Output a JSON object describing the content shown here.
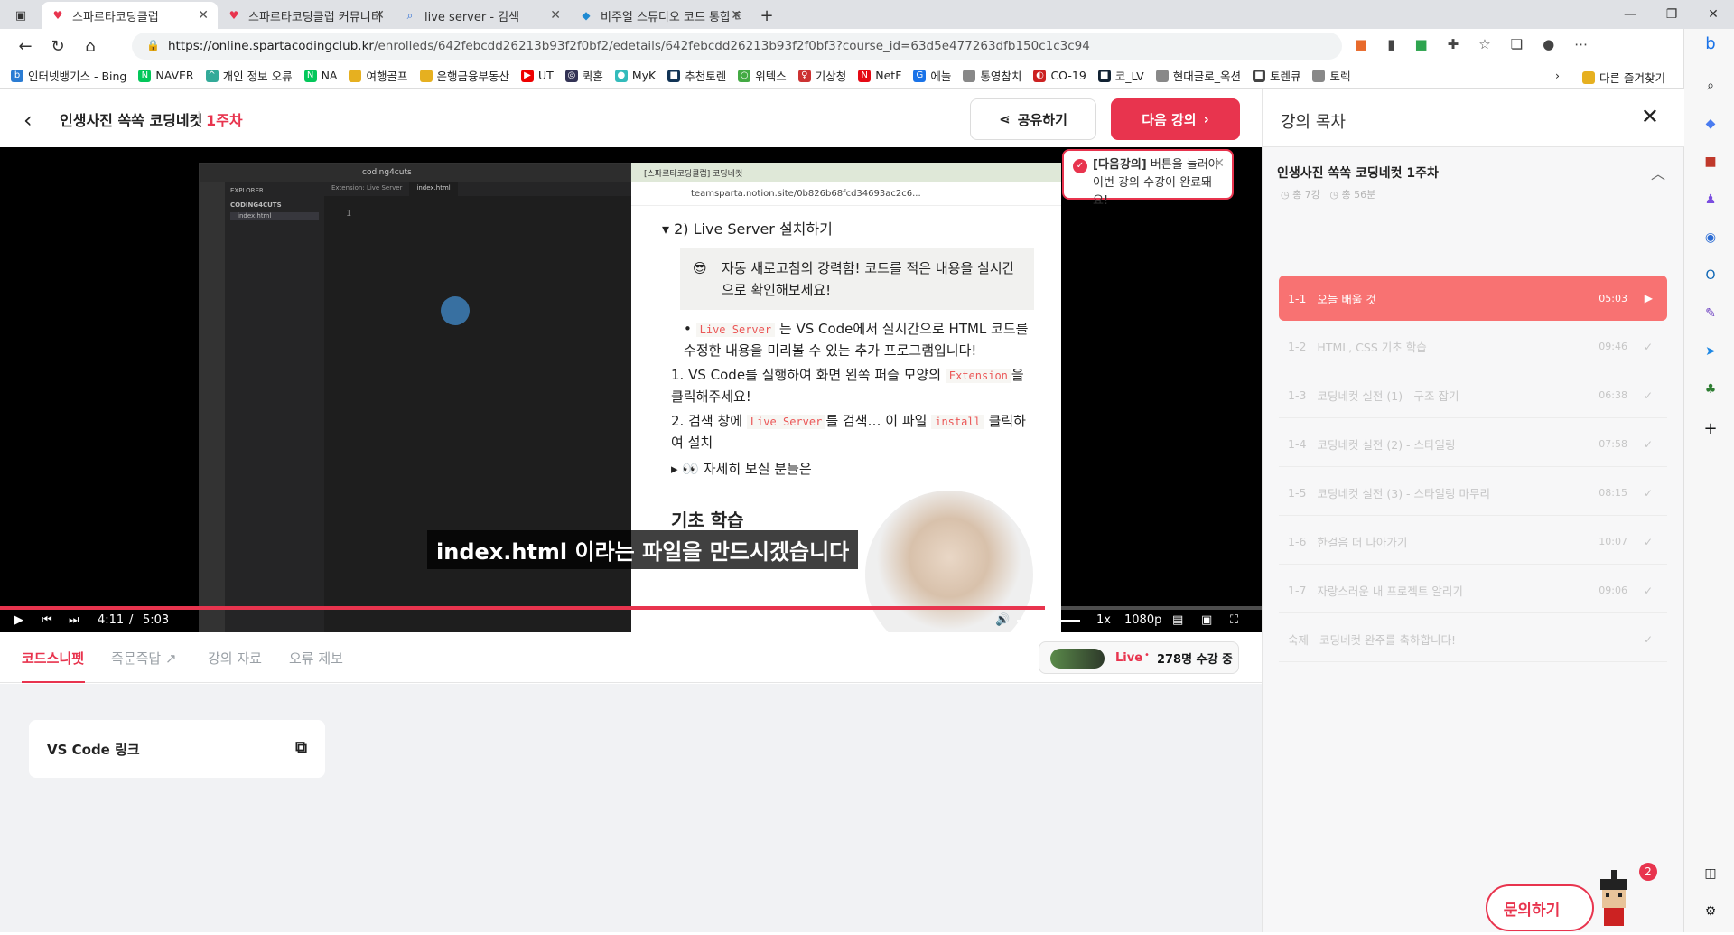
{
  "browser": {
    "tabs": [
      {
        "title": "스파르타코딩클럽",
        "active": true
      },
      {
        "title": "스파르타코딩클럽 커뮤니티 | 스파",
        "active": false
      },
      {
        "title": "live server - 검색",
        "active": false
      },
      {
        "title": "비주얼 스튜디오 코드 통합 터미",
        "active": false
      }
    ],
    "url_host": "https://online.spartacodingclub.kr",
    "url_path": "/enrolleds/642febcdd26213b93f2f0bf2/edetails/642febcdd26213b93f2f0bf3?course_id=63d5e477263dfb150c1c3c94",
    "bookmarks": [
      "인터넷뱅기스 - Bing",
      "NAVER",
      "개인 정보 오류",
      "NA",
      "여행골프",
      "은행금융부동산",
      "UT",
      "퀵홈",
      "MyK",
      "추천토렌",
      "위텍스",
      "기상청",
      "NetF",
      "에놀",
      "통영참치",
      "CO-19",
      "코_LV",
      "현대글로_옥션",
      "토렌큐",
      "토렉"
    ],
    "other_bookmarks": "다른 즐겨찾기"
  },
  "header": {
    "course_title": "인생사진 쏙쏙 코딩네컷",
    "week": "1주차",
    "share_label": "공유하기",
    "next_label": "다음 강의",
    "tooltip_strong": "[다음강의]",
    "tooltip_line1": " 버튼을 눌러야",
    "tooltip_line2": "이번 강의 수강이 완료돼요!"
  },
  "video": {
    "vscode_title": "coding4cuts",
    "vscode_explorer": "EXPLORER",
    "vscode_folder": "CODING4CUTS",
    "vscode_file": "index.html",
    "vscode_tab1": "Extension: Live Server",
    "vscode_tab2": "index.html",
    "vscode_line": "1",
    "notion_tab": "[스파르타코딩클럽] 코딩네컷",
    "notion_url": "teamsparta.notion.site/0b826b68fcd34693ac2c6...",
    "section": "2) Live Server 설치하기",
    "callout": "자동 새로고침의 강력함! 코드를 적은 내용을 실시간으로 확인해보세요!",
    "bullet_code": "Live Server",
    "bullet_text": " 는 VS Code에서 실시간으로 HTML 코드를 수정한 내용을 미리볼 수 있는 추가 프로그램입니다!",
    "step1_text": "VS Code를 실행하여 화면 왼쪽 퍼즐 모양의",
    "step1_code": "Extension",
    "step1_tail": "을 클릭해주세요!",
    "step2_text": "검색 창에",
    "step2_code": "Live Server",
    "step2_tail": "를 검색… 이 파일",
    "step2_code2": "install",
    "step2_tail2": " 클릭하여 설치",
    "toggle_text": "👀 자세히 보실 분들은",
    "below_text": "기초 학습",
    "subtitle": "index.html 이라는 파일을 만드시겠습니다",
    "current_time": "4:11",
    "separator": "/",
    "duration": "5:03",
    "progress": 0.828,
    "speed": "1x",
    "quality": "1080p"
  },
  "bottom_tabs": [
    "코드스니펫",
    "즉문즉답",
    "강의 자료",
    "오류 제보"
  ],
  "live": {
    "label": "Live",
    "count": "278명 수강 중"
  },
  "snippet": {
    "title": "VS Code 링크"
  },
  "toc": {
    "title": "강의 목차",
    "course": "인생사진 쏙쏙 코딩네컷 1주차",
    "meta_count": "총 7강",
    "meta_time": "총 56분",
    "lessons": [
      {
        "num": "1-1",
        "title": "오늘 배울 것",
        "dur": "05:03",
        "active": true
      },
      {
        "num": "1-2",
        "title": "HTML, CSS 기초 학습",
        "dur": "09:46",
        "active": false
      },
      {
        "num": "1-3",
        "title": "코딩네컷 실전 (1) - 구조 잡기",
        "dur": "06:38",
        "active": false
      },
      {
        "num": "1-4",
        "title": "코딩네컷 실전 (2) - 스타일링",
        "dur": "07:58",
        "active": false
      },
      {
        "num": "1-5",
        "title": "코딩네컷 실전 (3) - 스타일링 마무리",
        "dur": "08:15",
        "active": false
      },
      {
        "num": "1-6",
        "title": "한걸음 더 나아가기",
        "dur": "10:07",
        "active": false
      },
      {
        "num": "1-7",
        "title": "자랑스러운 내 프로젝트 알리기",
        "dur": "09:06",
        "active": false
      },
      {
        "num": "숙제",
        "title": "코딩네컷 완주를 축하합니다!",
        "dur": "",
        "active": false
      }
    ]
  },
  "ask": {
    "label": "문의하기",
    "badge": "2"
  },
  "colors": {
    "brand": "#e8344e",
    "active_lesson": "#f87272"
  }
}
